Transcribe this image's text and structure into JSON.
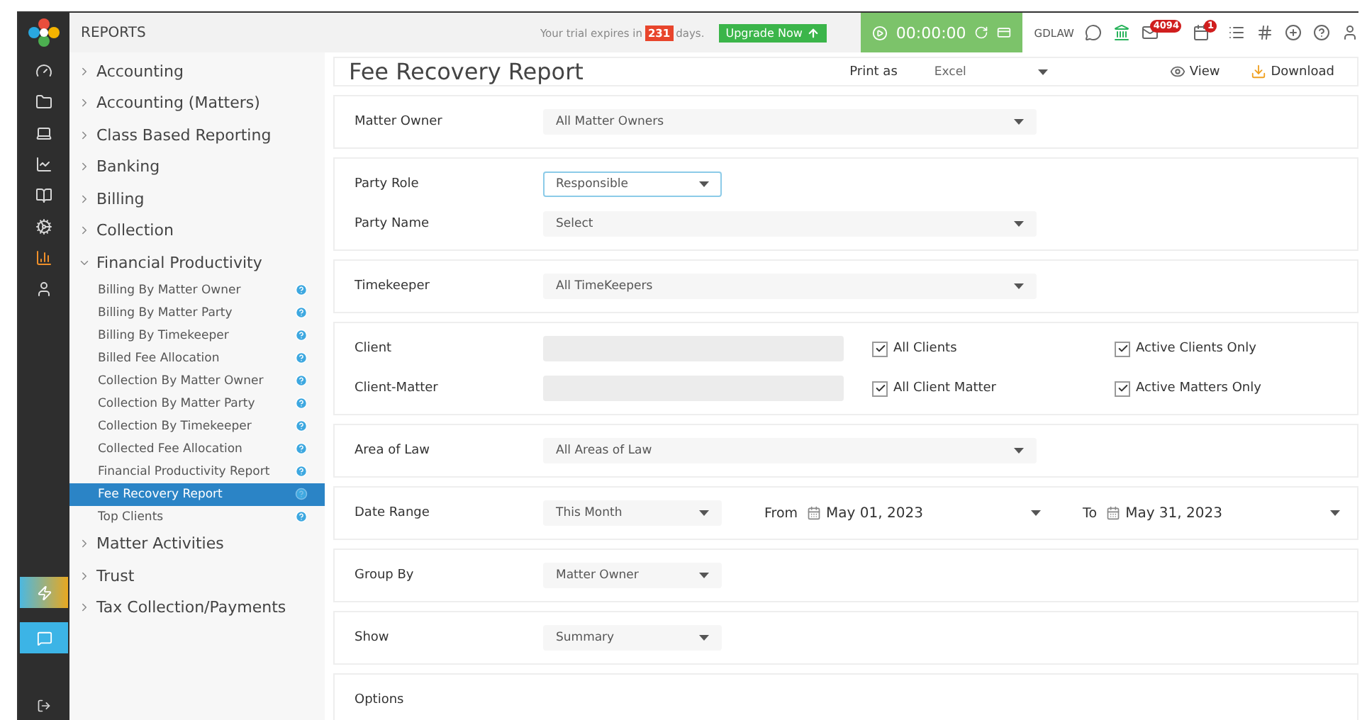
{
  "topbar": {
    "section": "REPORTS",
    "trial_prefix": "Your trial expires in",
    "trial_days": "231",
    "trial_suffix": "days.",
    "upgrade": "Upgrade Now",
    "timer": "00:00:00",
    "firm": "GDLAW",
    "mail_count": "4094",
    "calendar_count": "1"
  },
  "rail": [
    {
      "selected": false
    },
    {
      "selected": false
    },
    {
      "selected": false
    },
    {
      "selected": false
    },
    {
      "selected": false
    },
    {
      "selected": false
    },
    {
      "selected": true
    },
    {
      "selected": false
    }
  ],
  "sidebar": {
    "items": [
      {
        "label": "Accounting",
        "expanded": false
      },
      {
        "label": "Accounting (Matters)",
        "expanded": false
      },
      {
        "label": "Class Based Reporting",
        "expanded": false
      },
      {
        "label": "Banking",
        "expanded": false
      },
      {
        "label": "Billing",
        "expanded": false
      },
      {
        "label": "Collection",
        "expanded": false
      },
      {
        "label": "Financial Productivity",
        "expanded": true,
        "children": [
          {
            "label": "Billing By Matter Owner",
            "selected": false
          },
          {
            "label": "Billing By Matter Party",
            "selected": false
          },
          {
            "label": "Billing By Timekeeper",
            "selected": false
          },
          {
            "label": "Billed Fee Allocation",
            "selected": false
          },
          {
            "label": "Collection By Matter Owner",
            "selected": false
          },
          {
            "label": "Collection By Matter Party",
            "selected": false
          },
          {
            "label": "Collection By Timekeeper",
            "selected": false
          },
          {
            "label": "Collected Fee Allocation",
            "selected": false
          },
          {
            "label": "Financial Productivity Report",
            "selected": false
          },
          {
            "label": "Fee Recovery Report",
            "selected": true
          },
          {
            "label": "Top Clients",
            "selected": false
          }
        ]
      },
      {
        "label": "Matter Activities",
        "expanded": false
      },
      {
        "label": "Trust",
        "expanded": false
      },
      {
        "label": "Tax Collection/Payments",
        "expanded": false
      }
    ]
  },
  "report": {
    "title": "Fee Recovery Report",
    "print_label": "Print as",
    "print_format": "Excel",
    "view": "View",
    "download": "Download"
  },
  "groups": [
    {
      "fields": [
        {
          "kind": "combo",
          "label": "Matter Owner",
          "value": "All Matter Owners",
          "focused": false
        }
      ]
    },
    {
      "fields": [
        {
          "kind": "select",
          "label": "Party Role",
          "value": "Responsible",
          "focused": true
        },
        {
          "kind": "combo",
          "label": "Party Name",
          "value": "Select",
          "focused": false
        }
      ]
    },
    {
      "fields": [
        {
          "kind": "combo",
          "label": "Timekeeper",
          "value": "All TimeKeepers",
          "focused": false
        }
      ]
    },
    {
      "fields": [
        {
          "kind": "lookup",
          "label": "Client",
          "checks": [
            {
              "label": "All Clients",
              "checked": true
            },
            {
              "label": "Active Clients Only",
              "checked": true
            }
          ]
        },
        {
          "kind": "lookup",
          "label": "Client-Matter",
          "checks": [
            {
              "label": "All Client Matter",
              "checked": true
            },
            {
              "label": "Active Matters Only",
              "checked": true
            }
          ]
        }
      ]
    },
    {
      "fields": [
        {
          "kind": "combo",
          "label": "Area of Law",
          "value": "All Areas of Law",
          "focused": false
        }
      ]
    },
    {
      "fields": [
        {
          "kind": "daterange",
          "label": "Date Range",
          "value": "This Month",
          "from_label": "From",
          "from": "May 01, 2023",
          "to_label": "To",
          "to": "May 31, 2023"
        }
      ]
    },
    {
      "fields": [
        {
          "kind": "select",
          "label": "Group By",
          "value": "Matter Owner",
          "focused": false
        }
      ]
    },
    {
      "fields": [
        {
          "kind": "select",
          "label": "Show",
          "value": "Summary",
          "focused": false
        }
      ]
    },
    {
      "fields": [
        {
          "kind": "heading",
          "label": "Options"
        }
      ]
    }
  ]
}
